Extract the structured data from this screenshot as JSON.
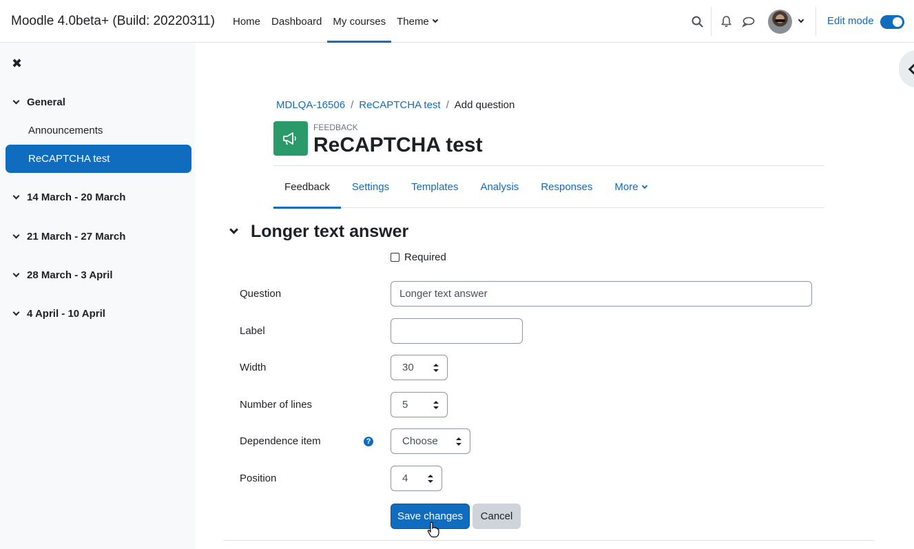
{
  "navbar": {
    "brand": "Moodle 4.0beta+ (Build: 20220311)",
    "links": [
      {
        "label": "Home"
      },
      {
        "label": "Dashboard"
      },
      {
        "label": "My courses"
      },
      {
        "label": "Theme"
      }
    ],
    "edit_mode_label": "Edit mode",
    "edit_mode_on": true
  },
  "drawer": {
    "sections": [
      {
        "label": "General"
      },
      {
        "label": "14 March - 20 March"
      },
      {
        "label": "21 March - 27 March"
      },
      {
        "label": "28 March - 3 April"
      },
      {
        "label": "4 April - 10 April"
      }
    ],
    "items": [
      {
        "label": "Announcements"
      },
      {
        "label": "ReCAPTCHA test"
      }
    ]
  },
  "breadcrumb": [
    "MDLQA-16506",
    "ReCAPTCHA test",
    "Add question"
  ],
  "header": {
    "module_type": "FEEDBACK",
    "title": "ReCAPTCHA test"
  },
  "tabs": [
    {
      "label": "Feedback"
    },
    {
      "label": "Settings"
    },
    {
      "label": "Templates"
    },
    {
      "label": "Analysis"
    },
    {
      "label": "Responses"
    },
    {
      "label": "More"
    }
  ],
  "form": {
    "legend": "Longer text answer",
    "required_label": "Required",
    "question": {
      "label": "Question",
      "value": "Longer text answer"
    },
    "label": {
      "label": "Label",
      "value": ""
    },
    "width": {
      "label": "Width",
      "value": "30"
    },
    "lines": {
      "label": "Number of lines",
      "value": "5"
    },
    "dependence": {
      "label": "Dependence item",
      "value": "Choose"
    },
    "position": {
      "label": "Position",
      "value": "4"
    },
    "save_label": "Save changes",
    "cancel_label": "Cancel"
  },
  "colors": {
    "primary": "#0f6cbf",
    "module_icon": "#2b9a6b",
    "drawer_bg": "#f8f9fa"
  }
}
